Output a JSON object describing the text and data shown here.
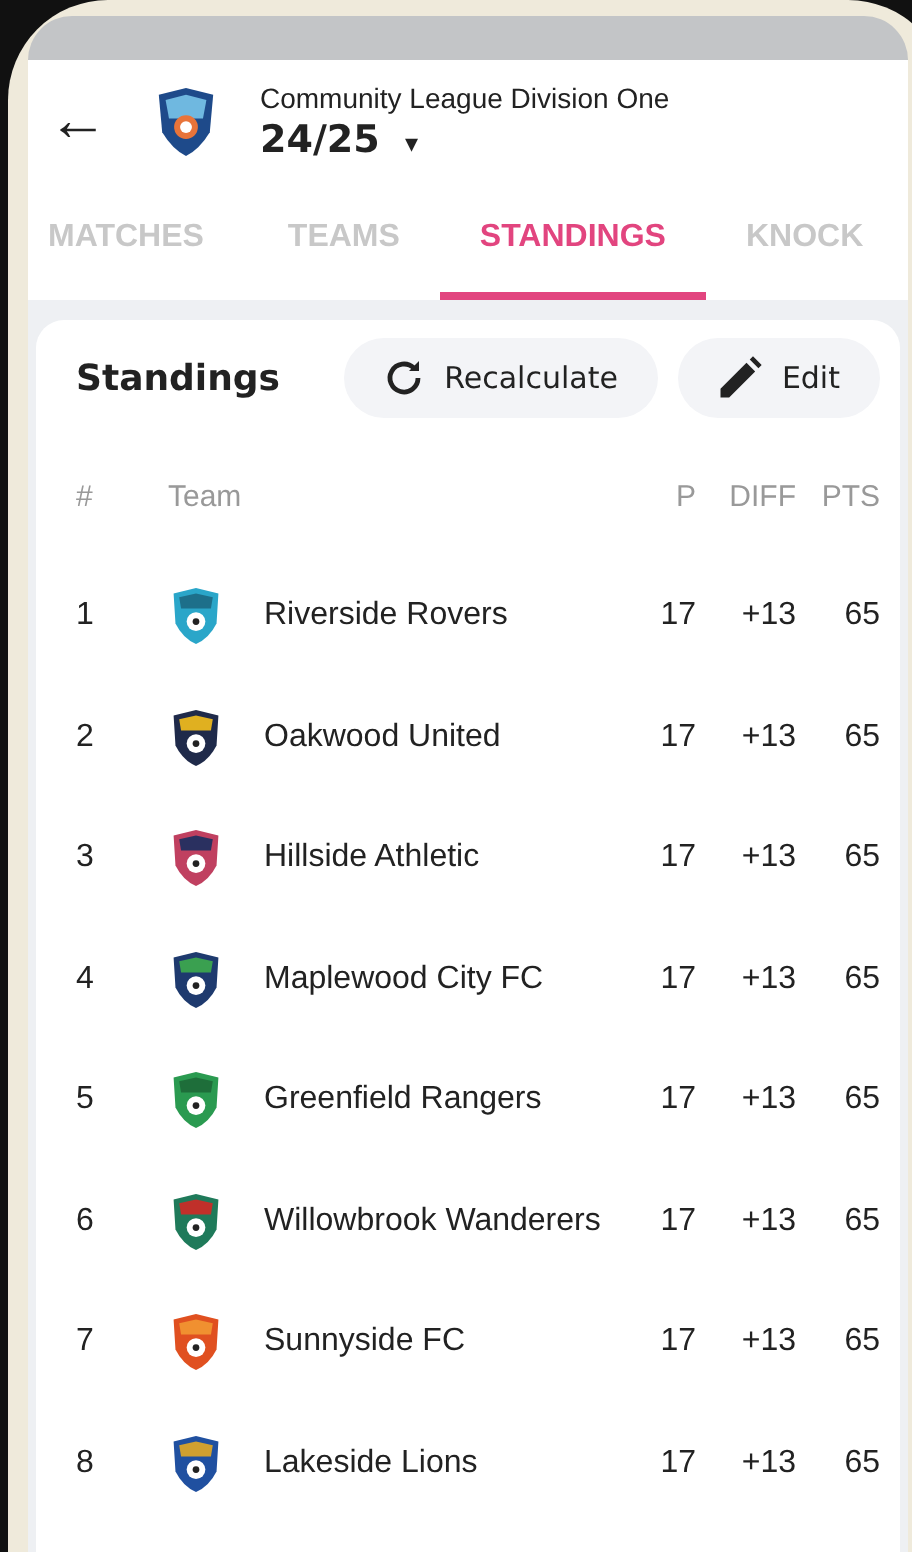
{
  "header": {
    "back": "←",
    "league": "Community League Division One",
    "season": "24/25",
    "caret": "▾"
  },
  "tabs": [
    {
      "label": "MATCHES",
      "selected": false
    },
    {
      "label": "TEAMS",
      "selected": false
    },
    {
      "label": "STANDINGS",
      "selected": true
    },
    {
      "label": "KNOCK",
      "selected": false
    }
  ],
  "card": {
    "title": "Standings",
    "buttons": [
      {
        "label": "Recalculate",
        "kind": "refresh"
      },
      {
        "label": "Edit",
        "kind": "edit"
      }
    ]
  },
  "table": {
    "columns": [
      "#",
      "Team",
      "P",
      "DIFF",
      "PTS"
    ],
    "rows": [
      {
        "rank": "1",
        "team": "Riverside Rovers",
        "p": "17",
        "diff": "+13",
        "pts": "65"
      },
      {
        "rank": "2",
        "team": "Oakwood United",
        "p": "17",
        "diff": "+13",
        "pts": "65"
      },
      {
        "rank": "3",
        "team": "Hillside Athletic",
        "p": "17",
        "diff": "+13",
        "pts": "65"
      },
      {
        "rank": "4",
        "team": "Maplewood City FC",
        "p": "17",
        "diff": "+13",
        "pts": "65"
      },
      {
        "rank": "5",
        "team": "Greenfield Rangers",
        "p": "17",
        "diff": "+13",
        "pts": "65"
      },
      {
        "rank": "6",
        "team": "Willowbrook Wanderers",
        "p": "17",
        "diff": "+13",
        "pts": "65"
      },
      {
        "rank": "7",
        "team": "Sunnyside FC",
        "p": "17",
        "diff": "+13",
        "pts": "65"
      },
      {
        "rank": "8",
        "team": "Lakeside Lions",
        "p": "17",
        "diff": "+13",
        "pts": "65"
      }
    ]
  }
}
